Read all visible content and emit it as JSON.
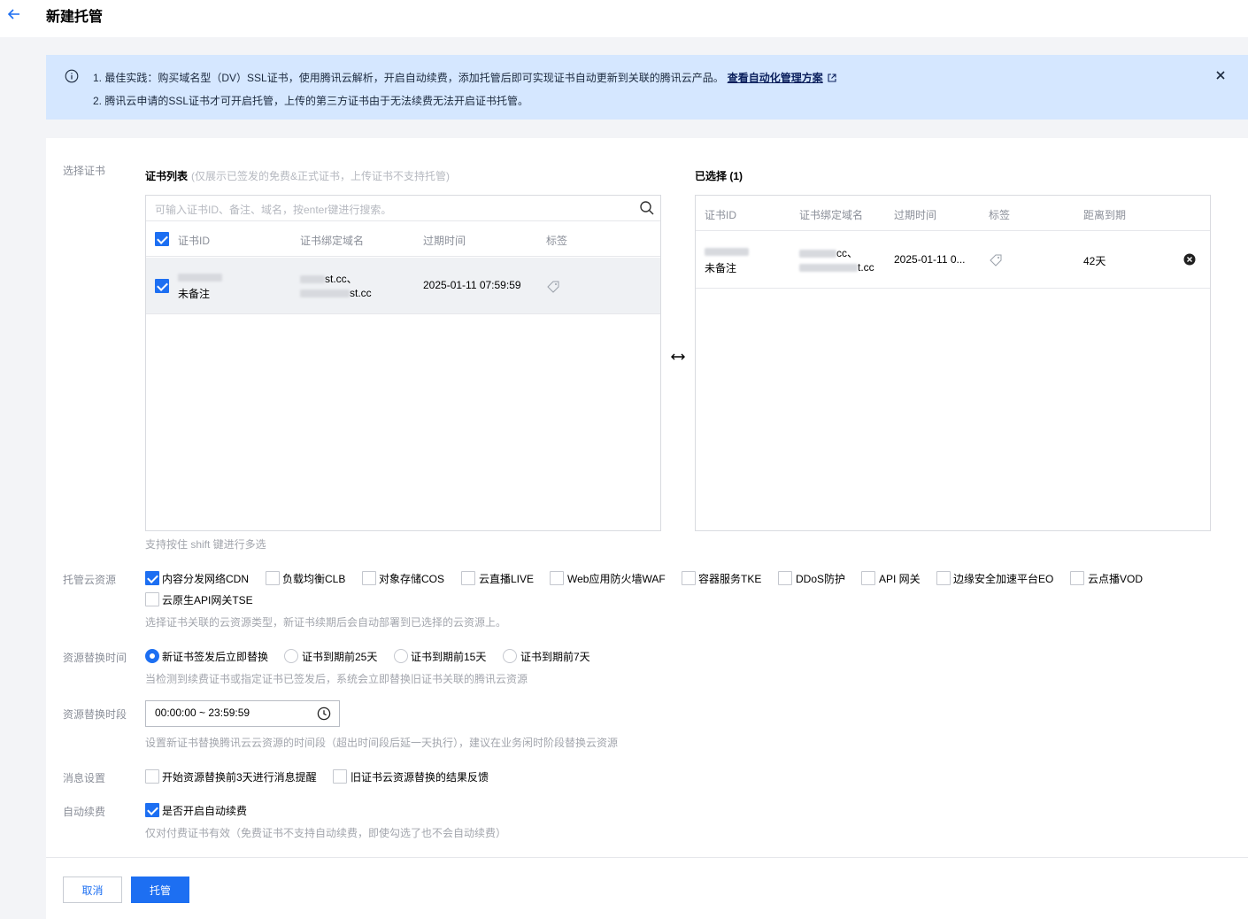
{
  "page": {
    "title": "新建托管"
  },
  "notice": {
    "line1": "1. 最佳实践：购买域名型（DV）SSL证书，使用腾讯云解析，开启自动续费，添加托管后即可实现证书自动更新到关联的腾讯云产品。",
    "link": "查看自动化管理方案",
    "line2": "2. 腾讯云申请的SSL证书才可开启托管，上传的第三方证书由于无法续费无法开启证书托管。"
  },
  "select_cert": {
    "label": "选择证书",
    "list_title": "证书列表",
    "list_subtitle": "(仅展示已签发的免费&正式证书，上传证书不支持托管)",
    "search_placeholder": "可输入证书ID、备注、域名，按enter键进行搜索。",
    "columns": [
      "证书ID",
      "证书绑定域名",
      "过期时间",
      "标签"
    ],
    "rows": [
      {
        "id_note": "未备注",
        "domain1": "st.cc、",
        "domain2": "st.cc",
        "expiry": "2025-01-11 07:59:59",
        "checked": true
      }
    ],
    "shift_hint": "支持按住 shift 键进行多选",
    "selected_title": "已选择 (1)",
    "selected_columns": [
      "证书ID",
      "证书绑定域名",
      "过期时间",
      "标签",
      "距离到期"
    ],
    "selected_rows": [
      {
        "id_note": "未备注",
        "domain1": "cc、",
        "domain2": "t.cc",
        "expiry": "2025-01-11 0...",
        "days_left": "42天"
      }
    ]
  },
  "resources": {
    "label": "托管云资源",
    "options": [
      {
        "label": "内容分发网络CDN",
        "checked": true
      },
      {
        "label": "负载均衡CLB",
        "checked": false
      },
      {
        "label": "对象存储COS",
        "checked": false
      },
      {
        "label": "云直播LIVE",
        "checked": false
      },
      {
        "label": "Web应用防火墙WAF",
        "checked": false
      },
      {
        "label": "容器服务TKE",
        "checked": false
      },
      {
        "label": "DDoS防护",
        "checked": false
      },
      {
        "label": "API 网关",
        "checked": false
      },
      {
        "label": "边缘安全加速平台EO",
        "checked": false
      },
      {
        "label": "云点播VOD",
        "checked": false
      },
      {
        "label": "云原生API网关TSE",
        "checked": false
      }
    ],
    "hint": "选择证书关联的云资源类型，新证书续期后会自动部署到已选择的云资源上。"
  },
  "replace_time": {
    "label": "资源替换时间",
    "options": [
      "新证书签发后立即替换",
      "证书到期前25天",
      "证书到期前15天",
      "证书到期前7天"
    ],
    "selected": 0,
    "hint": "当检测到续费证书或指定证书已签发后，系统会立即替换旧证书关联的腾讯云资源"
  },
  "replace_window": {
    "label": "资源替换时段",
    "value": "00:00:00 ~ 23:59:59",
    "hint": "设置新证书替换腾讯云云资源的时间段（超出时间段后延一天执行），建议在业务闲时阶段替换云资源"
  },
  "message": {
    "label": "消息设置",
    "options": [
      {
        "label": "开始资源替换前3天进行消息提醒",
        "checked": false
      },
      {
        "label": "旧证书云资源替换的结果反馈",
        "checked": false
      }
    ]
  },
  "auto_renew": {
    "label": "自动续费",
    "option": "是否开启自动续费",
    "checked": true,
    "hint": "仅对付费证书有效（免费证书不支持自动续费，即使勾选了也不会自动续费）"
  },
  "actions": {
    "cancel": "取消",
    "submit": "托管"
  },
  "colors": {
    "primary": "#1d6ff2",
    "notice_bg": "#d5e7ff",
    "page_bg": "#f3f4f7"
  }
}
